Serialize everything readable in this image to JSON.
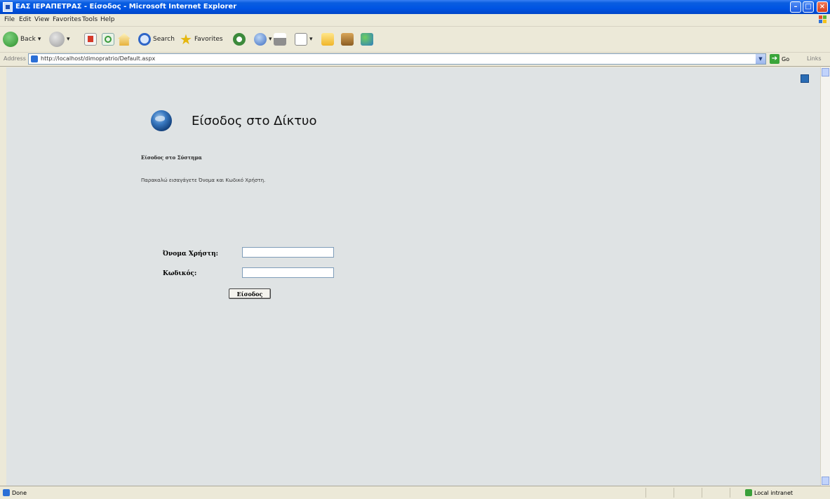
{
  "window": {
    "title": "ΕΑΣ ΙΕΡΑΠΕΤΡΑΣ - Είσοδος - Microsoft Internet Explorer"
  },
  "menu": [
    "File",
    "Edit",
    "View",
    "Favorites",
    "Tools",
    "Help"
  ],
  "toolbar": {
    "back": "Back",
    "search": "Search",
    "favorites": "Favorites"
  },
  "address": {
    "label": "Address",
    "url": "http://localhost/dimopratrio/Default.aspx",
    "go": "Go",
    "links": "Links"
  },
  "page": {
    "title": "Είσοδος στο Δίκτυο",
    "heading": "Είσοδος στο Σύστημα",
    "instruction": "Παρακαλώ εισαγάγετε Όνομα και Κωδικό Χρήστη.",
    "username_label": "Όνομα Χρήστη:",
    "password_label": "Κωδικός:",
    "username_value": "",
    "password_value": "",
    "submit_label": "Είσοδος"
  },
  "status": {
    "text": "Done",
    "zone": "Local intranet"
  },
  "colors": {
    "titlebar": "#0054e3",
    "content_bg": "#dfe3e4",
    "chrome": "#ece9d8"
  }
}
